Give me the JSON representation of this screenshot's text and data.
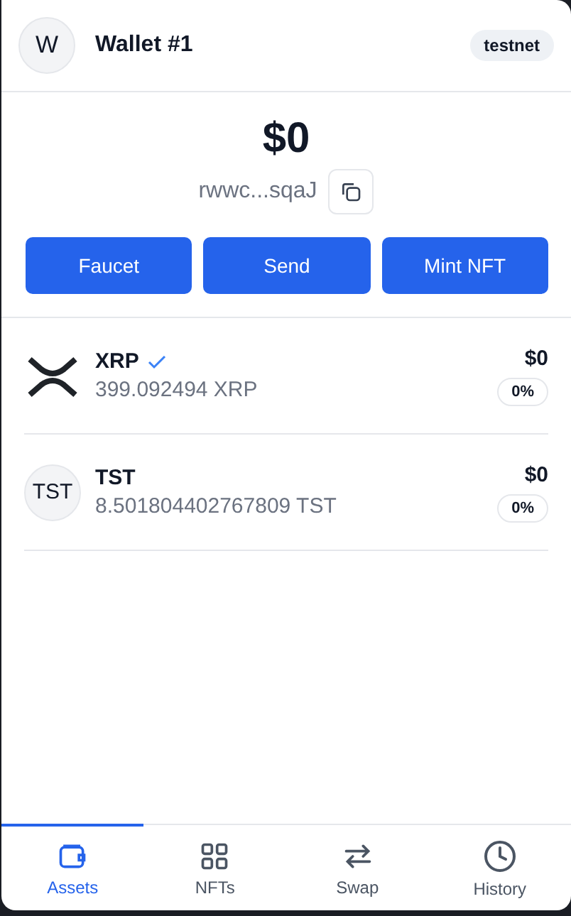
{
  "header": {
    "avatar": "W",
    "title": "Wallet #1",
    "network": "testnet"
  },
  "balance": {
    "total": "$0",
    "address": "rwwc...sqaJ"
  },
  "actions": [
    "Faucet",
    "Send",
    "Mint NFT"
  ],
  "assets": [
    {
      "kind": "xrp",
      "name": "XRP",
      "verified": true,
      "amount": "399.092494 XRP",
      "value": "$0",
      "change": "0%"
    },
    {
      "kind": "token",
      "icon_text": "TST",
      "name": "TST",
      "verified": false,
      "amount": "8.501804402767809 TST",
      "value": "$0",
      "change": "0%"
    }
  ],
  "nav": [
    {
      "kind": "assets",
      "label": "Assets",
      "selected": true
    },
    {
      "kind": "nfts",
      "label": "NFTs",
      "selected": false
    },
    {
      "kind": "swap",
      "label": "Swap",
      "selected": false
    },
    {
      "kind": "history",
      "label": "History",
      "selected": false
    }
  ]
}
